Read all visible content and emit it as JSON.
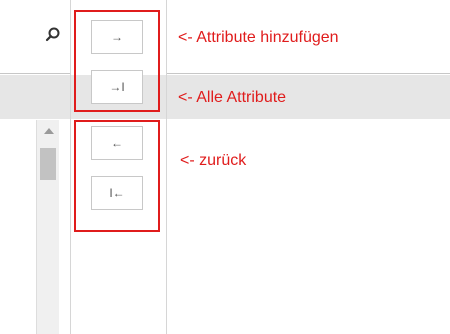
{
  "toolbar": {
    "search_icon": "search-icon"
  },
  "buttons": {
    "add_glyph": "→",
    "add_all_glyph": "→I",
    "remove_glyph": "←",
    "remove_all_glyph": "I←"
  },
  "annotations": {
    "add_attributes": "<- Attribute hinzufügen",
    "all_attributes": "<- Alle Attribute",
    "back": "<- zurück"
  },
  "colors": {
    "annotation_red": "#e01c1c",
    "row_highlight": "#e6e6e6"
  }
}
